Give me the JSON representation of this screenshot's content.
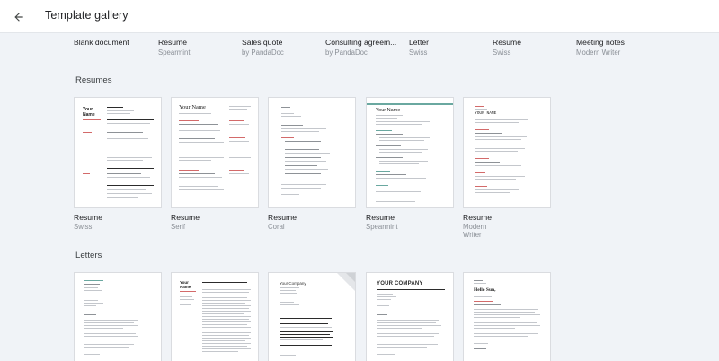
{
  "header": {
    "title": "Template gallery",
    "back_icon": "arrow-left-icon"
  },
  "recent": [
    {
      "name": "Blank document",
      "sub": ""
    },
    {
      "name": "Resume",
      "sub": "Spearmint"
    },
    {
      "name": "Sales quote",
      "sub": "by PandaDoc"
    },
    {
      "name": "Consulting agreem...",
      "sub": "by PandaDoc"
    },
    {
      "name": "Letter",
      "sub": "Swiss"
    },
    {
      "name": "Resume",
      "sub": "Swiss"
    },
    {
      "name": "Meeting notes",
      "sub": "Modern Writer"
    }
  ],
  "sections": {
    "resumes": {
      "title": "Resumes",
      "items": [
        {
          "name": "Resume",
          "sub": "Swiss",
          "thumb_text": [
            "Your",
            "Name"
          ]
        },
        {
          "name": "Resume",
          "sub": "Serif",
          "thumb_text": [
            "Your Name"
          ]
        },
        {
          "name": "Resume",
          "sub": "Coral",
          "thumb_text": []
        },
        {
          "name": "Resume",
          "sub": "Spearmint",
          "thumb_text": [
            "Your Name"
          ]
        },
        {
          "name": "Resume",
          "sub": "Modern Writer",
          "thumb_text": [
            "YOUR NAME"
          ]
        }
      ]
    },
    "letters": {
      "title": "Letters",
      "items": [
        {
          "thumb_text": []
        },
        {
          "thumb_text": [
            "Your",
            "Name"
          ]
        },
        {
          "thumb_text": [
            "Your Company"
          ]
        },
        {
          "thumb_text": [
            "YOUR COMPANY"
          ]
        },
        {
          "thumb_text": [
            "Hello Sun,"
          ]
        }
      ]
    }
  },
  "colors": {
    "background": "#f0f3f7",
    "header": "#ffffff",
    "accent_red": "#d36a6a",
    "accent_teal": "#6aa8a0"
  }
}
